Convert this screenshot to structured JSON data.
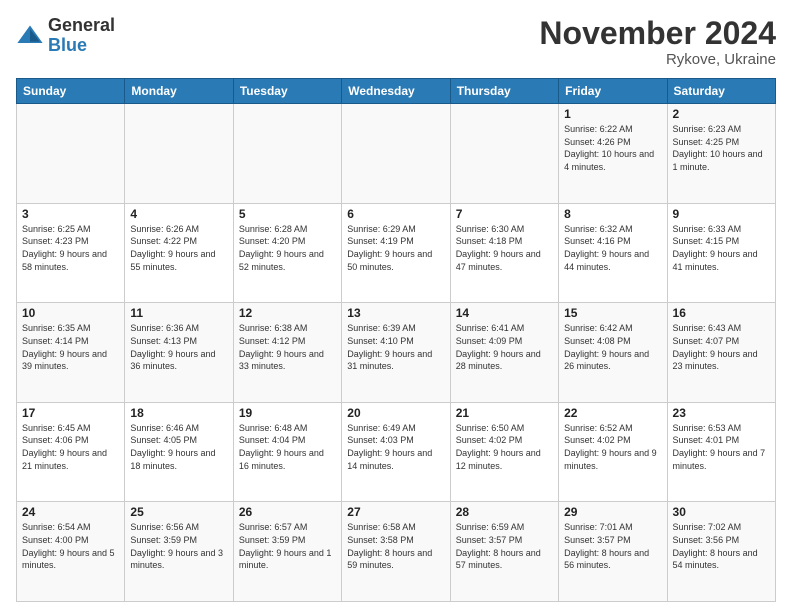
{
  "header": {
    "logo_general": "General",
    "logo_blue": "Blue",
    "month_title": "November 2024",
    "location": "Rykove, Ukraine"
  },
  "days_of_week": [
    "Sunday",
    "Monday",
    "Tuesday",
    "Wednesday",
    "Thursday",
    "Friday",
    "Saturday"
  ],
  "weeks": [
    [
      {
        "day": "",
        "sunrise": "",
        "sunset": "",
        "daylight": ""
      },
      {
        "day": "",
        "sunrise": "",
        "sunset": "",
        "daylight": ""
      },
      {
        "day": "",
        "sunrise": "",
        "sunset": "",
        "daylight": ""
      },
      {
        "day": "",
        "sunrise": "",
        "sunset": "",
        "daylight": ""
      },
      {
        "day": "",
        "sunrise": "",
        "sunset": "",
        "daylight": ""
      },
      {
        "day": "1",
        "sunrise": "Sunrise: 6:22 AM",
        "sunset": "Sunset: 4:26 PM",
        "daylight": "Daylight: 10 hours and 4 minutes."
      },
      {
        "day": "2",
        "sunrise": "Sunrise: 6:23 AM",
        "sunset": "Sunset: 4:25 PM",
        "daylight": "Daylight: 10 hours and 1 minute."
      }
    ],
    [
      {
        "day": "3",
        "sunrise": "Sunrise: 6:25 AM",
        "sunset": "Sunset: 4:23 PM",
        "daylight": "Daylight: 9 hours and 58 minutes."
      },
      {
        "day": "4",
        "sunrise": "Sunrise: 6:26 AM",
        "sunset": "Sunset: 4:22 PM",
        "daylight": "Daylight: 9 hours and 55 minutes."
      },
      {
        "day": "5",
        "sunrise": "Sunrise: 6:28 AM",
        "sunset": "Sunset: 4:20 PM",
        "daylight": "Daylight: 9 hours and 52 minutes."
      },
      {
        "day": "6",
        "sunrise": "Sunrise: 6:29 AM",
        "sunset": "Sunset: 4:19 PM",
        "daylight": "Daylight: 9 hours and 50 minutes."
      },
      {
        "day": "7",
        "sunrise": "Sunrise: 6:30 AM",
        "sunset": "Sunset: 4:18 PM",
        "daylight": "Daylight: 9 hours and 47 minutes."
      },
      {
        "day": "8",
        "sunrise": "Sunrise: 6:32 AM",
        "sunset": "Sunset: 4:16 PM",
        "daylight": "Daylight: 9 hours and 44 minutes."
      },
      {
        "day": "9",
        "sunrise": "Sunrise: 6:33 AM",
        "sunset": "Sunset: 4:15 PM",
        "daylight": "Daylight: 9 hours and 41 minutes."
      }
    ],
    [
      {
        "day": "10",
        "sunrise": "Sunrise: 6:35 AM",
        "sunset": "Sunset: 4:14 PM",
        "daylight": "Daylight: 9 hours and 39 minutes."
      },
      {
        "day": "11",
        "sunrise": "Sunrise: 6:36 AM",
        "sunset": "Sunset: 4:13 PM",
        "daylight": "Daylight: 9 hours and 36 minutes."
      },
      {
        "day": "12",
        "sunrise": "Sunrise: 6:38 AM",
        "sunset": "Sunset: 4:12 PM",
        "daylight": "Daylight: 9 hours and 33 minutes."
      },
      {
        "day": "13",
        "sunrise": "Sunrise: 6:39 AM",
        "sunset": "Sunset: 4:10 PM",
        "daylight": "Daylight: 9 hours and 31 minutes."
      },
      {
        "day": "14",
        "sunrise": "Sunrise: 6:41 AM",
        "sunset": "Sunset: 4:09 PM",
        "daylight": "Daylight: 9 hours and 28 minutes."
      },
      {
        "day": "15",
        "sunrise": "Sunrise: 6:42 AM",
        "sunset": "Sunset: 4:08 PM",
        "daylight": "Daylight: 9 hours and 26 minutes."
      },
      {
        "day": "16",
        "sunrise": "Sunrise: 6:43 AM",
        "sunset": "Sunset: 4:07 PM",
        "daylight": "Daylight: 9 hours and 23 minutes."
      }
    ],
    [
      {
        "day": "17",
        "sunrise": "Sunrise: 6:45 AM",
        "sunset": "Sunset: 4:06 PM",
        "daylight": "Daylight: 9 hours and 21 minutes."
      },
      {
        "day": "18",
        "sunrise": "Sunrise: 6:46 AM",
        "sunset": "Sunset: 4:05 PM",
        "daylight": "Daylight: 9 hours and 18 minutes."
      },
      {
        "day": "19",
        "sunrise": "Sunrise: 6:48 AM",
        "sunset": "Sunset: 4:04 PM",
        "daylight": "Daylight: 9 hours and 16 minutes."
      },
      {
        "day": "20",
        "sunrise": "Sunrise: 6:49 AM",
        "sunset": "Sunset: 4:03 PM",
        "daylight": "Daylight: 9 hours and 14 minutes."
      },
      {
        "day": "21",
        "sunrise": "Sunrise: 6:50 AM",
        "sunset": "Sunset: 4:02 PM",
        "daylight": "Daylight: 9 hours and 12 minutes."
      },
      {
        "day": "22",
        "sunrise": "Sunrise: 6:52 AM",
        "sunset": "Sunset: 4:02 PM",
        "daylight": "Daylight: 9 hours and 9 minutes."
      },
      {
        "day": "23",
        "sunrise": "Sunrise: 6:53 AM",
        "sunset": "Sunset: 4:01 PM",
        "daylight": "Daylight: 9 hours and 7 minutes."
      }
    ],
    [
      {
        "day": "24",
        "sunrise": "Sunrise: 6:54 AM",
        "sunset": "Sunset: 4:00 PM",
        "daylight": "Daylight: 9 hours and 5 minutes."
      },
      {
        "day": "25",
        "sunrise": "Sunrise: 6:56 AM",
        "sunset": "Sunset: 3:59 PM",
        "daylight": "Daylight: 9 hours and 3 minutes."
      },
      {
        "day": "26",
        "sunrise": "Sunrise: 6:57 AM",
        "sunset": "Sunset: 3:59 PM",
        "daylight": "Daylight: 9 hours and 1 minute."
      },
      {
        "day": "27",
        "sunrise": "Sunrise: 6:58 AM",
        "sunset": "Sunset: 3:58 PM",
        "daylight": "Daylight: 8 hours and 59 minutes."
      },
      {
        "day": "28",
        "sunrise": "Sunrise: 6:59 AM",
        "sunset": "Sunset: 3:57 PM",
        "daylight": "Daylight: 8 hours and 57 minutes."
      },
      {
        "day": "29",
        "sunrise": "Sunrise: 7:01 AM",
        "sunset": "Sunset: 3:57 PM",
        "daylight": "Daylight: 8 hours and 56 minutes."
      },
      {
        "day": "30",
        "sunrise": "Sunrise: 7:02 AM",
        "sunset": "Sunset: 3:56 PM",
        "daylight": "Daylight: 8 hours and 54 minutes."
      }
    ]
  ]
}
